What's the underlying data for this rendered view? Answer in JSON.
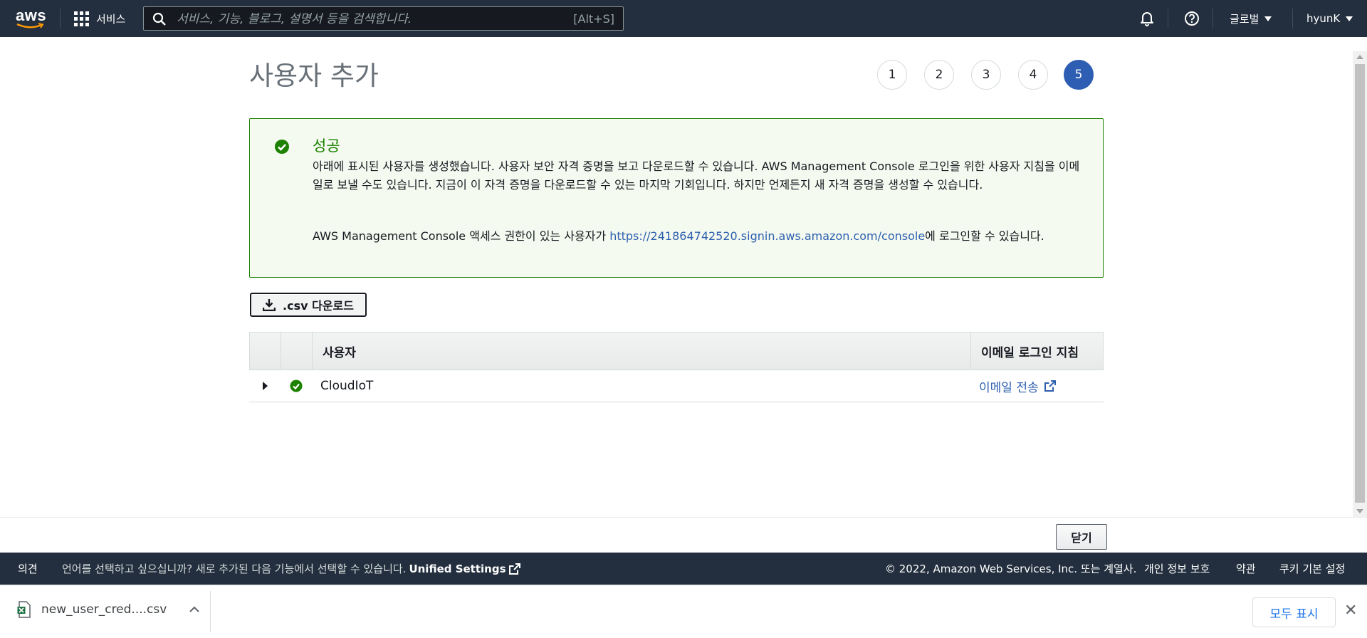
{
  "nav": {
    "logo": "aws",
    "services": "서비스",
    "search_placeholder": "서비스, 기능, 블로그, 설명서 등을 검색합니다.",
    "search_shortcut": "[Alt+S]",
    "region": "글로벌",
    "user": "hyunK"
  },
  "page": {
    "title": "사용자 추가"
  },
  "steps": [
    {
      "label": "1",
      "active": false
    },
    {
      "label": "2",
      "active": false
    },
    {
      "label": "3",
      "active": false
    },
    {
      "label": "4",
      "active": false
    },
    {
      "label": "5",
      "active": true
    }
  ],
  "alert": {
    "title": "성공",
    "message": "아래에 표시된 사용자를 생성했습니다. 사용자 보안 자격 증명을 보고 다운로드할 수 있습니다. AWS Management Console 로그인을 위한 사용자 지침을 이메일로 보낼 수도 있습니다. 지금이 이 자격 증명을 다운로드할 수 있는 마지막 기회입니다. 하지만 언제든지 새 자격 증명을 생성할 수 있습니다.",
    "console_prefix": "AWS Management Console 액세스 권한이 있는 사용자가 ",
    "console_link": "https://241864742520.signin.aws.amazon.com/console",
    "console_suffix": "에 로그인할 수 있습니다."
  },
  "csv_button": ".csv 다운로드",
  "table": {
    "col_user": "사용자",
    "col_email": "이메일 로그인 지침",
    "rows": [
      {
        "user": "CloudIoT",
        "email_action": "이메일 전송"
      }
    ]
  },
  "actions": {
    "close": "닫기"
  },
  "footer": {
    "feedback": "의견",
    "language_note": "언어를 선택하고 싶으십니까? 새로 추가된 다음 기능에서 선택할 수 있습니다.",
    "unified_settings": "Unified Settings",
    "copyright": "© 2022, Amazon Web Services, Inc. 또는 계열사.",
    "privacy": "개인 정보 보호",
    "terms": "약관",
    "cookies": "쿠키 기본 설정"
  },
  "download_shelf": {
    "file_name": "new_user_cred....csv",
    "show_all": "모두 표시"
  },
  "colors": {
    "nav_bg": "#232f3e",
    "success_green": "#1d8102",
    "success_bg": "#f4faf0",
    "link_blue": "#2d5fae",
    "step_active": "#2e5eb3"
  }
}
